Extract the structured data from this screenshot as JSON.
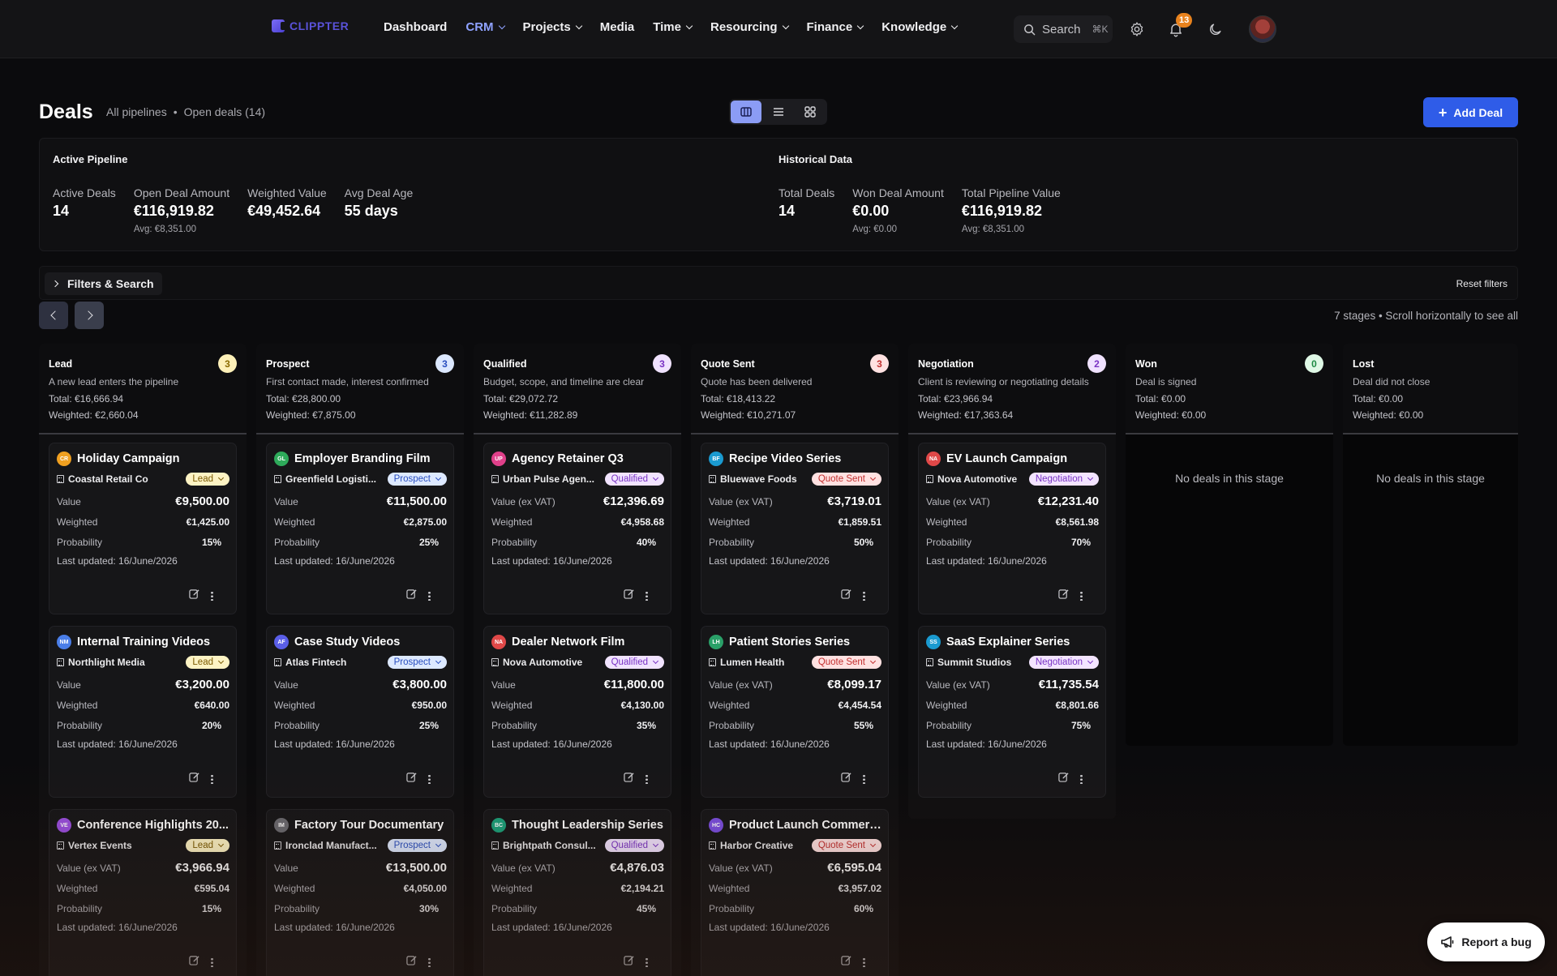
{
  "nav": {
    "logo": "CLIPPTER",
    "items": [
      {
        "label": "Dashboard",
        "dropdown": false,
        "active": false
      },
      {
        "label": "CRM",
        "dropdown": true,
        "active": true
      },
      {
        "label": "Projects",
        "dropdown": true,
        "active": false
      },
      {
        "label": "Media",
        "dropdown": false,
        "active": false
      },
      {
        "label": "Time",
        "dropdown": true,
        "active": false
      },
      {
        "label": "Resourcing",
        "dropdown": true,
        "active": false
      },
      {
        "label": "Finance",
        "dropdown": true,
        "active": false
      },
      {
        "label": "Knowledge",
        "dropdown": true,
        "active": false
      }
    ],
    "search_label": "Search",
    "search_shortcut": "⌘K",
    "notification_count": "13"
  },
  "header": {
    "title": "Deals",
    "scope": "All pipelines",
    "separator": "•",
    "open_deals": "Open deals (14)",
    "add_deal": "Add Deal"
  },
  "stats": {
    "active": {
      "heading": "Active Pipeline",
      "items": [
        {
          "label": "Active Deals",
          "value": "14",
          "avg": ""
        },
        {
          "label": "Open Deal Amount",
          "value": "€116,919.82",
          "avg": "Avg: €8,351.00"
        },
        {
          "label": "Weighted Value",
          "value": "€49,452.64",
          "avg": ""
        },
        {
          "label": "Avg Deal Age",
          "value": "55 days",
          "avg": ""
        }
      ]
    },
    "historical": {
      "heading": "Historical Data",
      "items": [
        {
          "label": "Total Deals",
          "value": "14",
          "avg": ""
        },
        {
          "label": "Won Deal Amount",
          "value": "€0.00",
          "avg": "Avg: €0.00"
        },
        {
          "label": "Total Pipeline Value",
          "value": "€116,919.82",
          "avg": "Avg: €8,351.00"
        }
      ]
    }
  },
  "filters": {
    "label": "Filters & Search",
    "reset": "Reset filters",
    "stages_info": "7 stages • Scroll horizontally to see all"
  },
  "colors": {
    "accent": "#2f5ce8",
    "lead_pill_bg": "#fdf3c4",
    "lead_pill_fg": "#7a5a00",
    "prospect_pill_bg": "#dde9ff",
    "prospect_pill_fg": "#2a4fbf",
    "qualified_pill_bg": "#f1e3ff",
    "qualified_pill_fg": "#7a33c4",
    "quote_pill_bg": "#ffe1e1",
    "quote_pill_fg": "#c23030",
    "negotiation_pill_bg": "#f3e4ff",
    "negotiation_pill_fg": "#7a33c4"
  },
  "columns": [
    {
      "name": "Lead",
      "count": "3",
      "count_bg": "#fdf0b8",
      "count_fg": "#8a6a00",
      "description": "A new lead enters the pipeline",
      "total": "Total: €16,666.94",
      "weighted": "Weighted: €2,660.04",
      "pill_bg": "#fdf3c4",
      "pill_fg": "#7a5a00",
      "empty_text": "",
      "deals": [
        {
          "initials": "CR",
          "color": "#f0a020",
          "title": "Holiday Campaign",
          "company": "Coastal Retail Co",
          "stage": "Lead",
          "value_label": "Value",
          "value": "€9,500.00",
          "weighted_label": "Weighted",
          "weighted": "€1,425.00",
          "prob_label": "Probability",
          "probability": "15%",
          "updated": "Last updated: 16/June/2026"
        },
        {
          "initials": "NM",
          "color": "#4a7ee8",
          "title": "Internal Training Videos",
          "company": "Northlight Media",
          "stage": "Lead",
          "value_label": "Value",
          "value": "€3,200.00",
          "weighted_label": "Weighted",
          "weighted": "€640.00",
          "prob_label": "Probability",
          "probability": "20%",
          "updated": "Last updated: 16/June/2026"
        },
        {
          "initials": "VE",
          "color": "#9a4ee0",
          "title": "Conference Highlights 20...",
          "company": "Vertex Events",
          "stage": "Lead",
          "value_label": "Value (ex VAT)",
          "value": "€3,966.94",
          "weighted_label": "Weighted",
          "weighted": "€595.04",
          "prob_label": "Probability",
          "probability": "15%",
          "updated": "Last updated: 16/June/2026"
        }
      ]
    },
    {
      "name": "Prospect",
      "count": "3",
      "count_bg": "#dce8ff",
      "count_fg": "#2a4fbf",
      "description": "First contact made, interest confirmed",
      "total": "Total: €28,800.00",
      "weighted": "Weighted: €7,875.00",
      "pill_bg": "#dde9ff",
      "pill_fg": "#2a4fbf",
      "empty_text": "",
      "deals": [
        {
          "initials": "GL",
          "color": "#2eaa5a",
          "title": "Employer Branding Film",
          "company": "Greenfield Logisti...",
          "stage": "Prospect",
          "value_label": "Value",
          "value": "€11,500.00",
          "weighted_label": "Weighted",
          "weighted": "€2,875.00",
          "prob_label": "Probability",
          "probability": "25%",
          "updated": "Last updated: 16/June/2026"
        },
        {
          "initials": "AF",
          "color": "#5a5ee8",
          "title": "Case Study Videos",
          "company": "Atlas Fintech",
          "stage": "Prospect",
          "value_label": "Value",
          "value": "€3,800.00",
          "weighted_label": "Weighted",
          "weighted": "€950.00",
          "prob_label": "Probability",
          "probability": "25%",
          "updated": "Last updated: 16/June/2026"
        },
        {
          "initials": "IM",
          "color": "#6a6a70",
          "title": "Factory Tour Documentary",
          "company": "Ironclad Manufact...",
          "stage": "Prospect",
          "value_label": "Value",
          "value": "€13,500.00",
          "weighted_label": "Weighted",
          "weighted": "€4,050.00",
          "prob_label": "Probability",
          "probability": "30%",
          "updated": "Last updated: 16/June/2026"
        }
      ]
    },
    {
      "name": "Qualified",
      "count": "3",
      "count_bg": "#f0e2ff",
      "count_fg": "#7a33c4",
      "description": "Budget, scope, and timeline are clear",
      "total": "Total: €29,072.72",
      "weighted": "Weighted: €11,282.89",
      "pill_bg": "#f1e3ff",
      "pill_fg": "#7a33c4",
      "empty_text": "",
      "deals": [
        {
          "initials": "UP",
          "color": "#e0408a",
          "title": "Agency Retainer Q3",
          "company": "Urban Pulse Agen...",
          "stage": "Qualified",
          "value_label": "Value (ex VAT)",
          "value": "€12,396.69",
          "weighted_label": "Weighted",
          "weighted": "€4,958.68",
          "prob_label": "Probability",
          "probability": "40%",
          "updated": "Last updated: 16/June/2026"
        },
        {
          "initials": "NA",
          "color": "#e04848",
          "title": "Dealer Network Film",
          "company": "Nova Automotive",
          "stage": "Qualified",
          "value_label": "Value",
          "value": "€11,800.00",
          "weighted_label": "Weighted",
          "weighted": "€4,130.00",
          "prob_label": "Probability",
          "probability": "35%",
          "updated": "Last updated: 16/June/2026"
        },
        {
          "initials": "BC",
          "color": "#1aa07a",
          "title": "Thought Leadership Series",
          "company": "Brightpath Consul...",
          "stage": "Qualified",
          "value_label": "Value (ex VAT)",
          "value": "€4,876.03",
          "weighted_label": "Weighted",
          "weighted": "€2,194.21",
          "prob_label": "Probability",
          "probability": "45%",
          "updated": "Last updated: 16/June/2026"
        }
      ]
    },
    {
      "name": "Quote Sent",
      "count": "3",
      "count_bg": "#ffe1e1",
      "count_fg": "#c23030",
      "description": "Quote has been delivered",
      "total": "Total: €18,413.22",
      "weighted": "Weighted: €10,271.07",
      "pill_bg": "#ffe1e1",
      "pill_fg": "#c23030",
      "empty_text": "",
      "deals": [
        {
          "initials": "BF",
          "color": "#1a9ad0",
          "title": "Recipe Video Series",
          "company": "Bluewave Foods",
          "stage": "Quote Sent",
          "value_label": "Value (ex VAT)",
          "value": "€3,719.01",
          "weighted_label": "Weighted",
          "weighted": "€1,859.51",
          "prob_label": "Probability",
          "probability": "50%",
          "updated": "Last updated: 16/June/2026"
        },
        {
          "initials": "LH",
          "color": "#2aa068",
          "title": "Patient Stories Series",
          "company": "Lumen Health",
          "stage": "Quote Sent",
          "value_label": "Value (ex VAT)",
          "value": "€8,099.17",
          "weighted_label": "Weighted",
          "weighted": "€4,454.54",
          "prob_label": "Probability",
          "probability": "55%",
          "updated": "Last updated: 16/June/2026"
        },
        {
          "initials": "HC",
          "color": "#7a4ee0",
          "title": "Product Launch Commerci...",
          "company": "Harbor Creative",
          "stage": "Quote Sent",
          "value_label": "Value (ex VAT)",
          "value": "€6,595.04",
          "weighted_label": "Weighted",
          "weighted": "€3,957.02",
          "prob_label": "Probability",
          "probability": "60%",
          "updated": "Last updated: 16/June/2026"
        }
      ]
    },
    {
      "name": "Negotiation",
      "count": "2",
      "count_bg": "#f0e2ff",
      "count_fg": "#7a33c4",
      "description": "Client is reviewing or negotiating details",
      "total": "Total: €23,966.94",
      "weighted": "Weighted: €17,363.64",
      "pill_bg": "#f3e4ff",
      "pill_fg": "#7a33c4",
      "empty_text": "",
      "deals": [
        {
          "initials": "NA",
          "color": "#e04848",
          "title": "EV Launch Campaign",
          "company": "Nova Automotive",
          "stage": "Negotiation",
          "value_label": "Value (ex VAT)",
          "value": "€12,231.40",
          "weighted_label": "Weighted",
          "weighted": "€8,561.98",
          "prob_label": "Probability",
          "probability": "70%",
          "updated": "Last updated: 16/June/2026"
        },
        {
          "initials": "SS",
          "color": "#1a9ad0",
          "title": "SaaS Explainer Series",
          "company": "Summit Studios",
          "stage": "Negotiation",
          "value_label": "Value (ex VAT)",
          "value": "€11,735.54",
          "weighted_label": "Weighted",
          "weighted": "€8,801.66",
          "prob_label": "Probability",
          "probability": "75%",
          "updated": "Last updated: 16/June/2026"
        }
      ]
    },
    {
      "name": "Won",
      "count": "0",
      "count_bg": "#dff8e6",
      "count_fg": "#1e8a44",
      "description": "Deal is signed",
      "total": "Total: €0.00",
      "weighted": "Weighted: €0.00",
      "pill_bg": "",
      "pill_fg": "",
      "empty_text": "No deals in this stage",
      "deals": []
    },
    {
      "name": "Lost",
      "count": "",
      "count_bg": "",
      "count_fg": "",
      "description": "Deal did not close",
      "total": "Total: €0.00",
      "weighted": "Weighted: €0.00",
      "pill_bg": "",
      "pill_fg": "",
      "empty_text": "No deals in this stage",
      "deals": []
    }
  ],
  "report_bug": "Report a bug"
}
